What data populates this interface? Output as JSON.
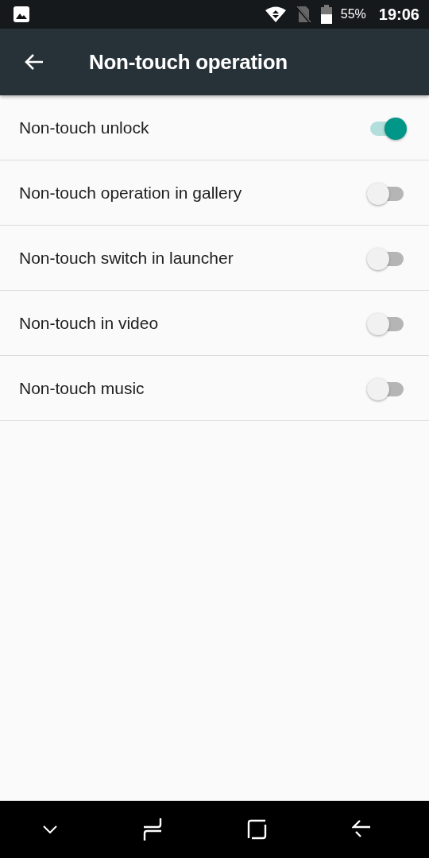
{
  "status_bar": {
    "battery": "55%",
    "time": "19:06"
  },
  "app_bar": {
    "title": "Non-touch operation"
  },
  "settings": [
    {
      "label": "Non-touch unlock",
      "on": true
    },
    {
      "label": "Non-touch operation in gallery",
      "on": false
    },
    {
      "label": "Non-touch switch in launcher",
      "on": false
    },
    {
      "label": "Non-touch in video",
      "on": false
    },
    {
      "label": "Non-touch music",
      "on": false
    }
  ]
}
